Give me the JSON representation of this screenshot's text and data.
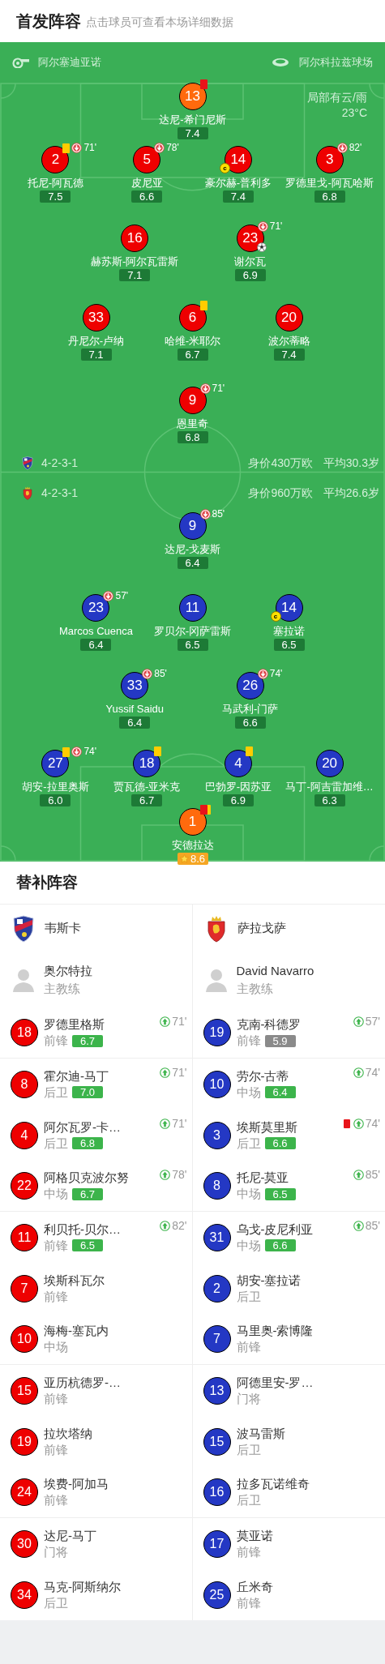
{
  "header": {
    "title": "首发阵容",
    "subtitle": "点击球员可查看本场详细数据"
  },
  "pitch": {
    "referee": "阿尔塞迪亚诺",
    "stadium": "阿尔科拉兹球场",
    "weather": "局部有云/雨",
    "temperature": "23°C",
    "home": {
      "lines": [
        {
          "players": [
            {
              "number": "13",
              "name": "达尼-希门尼斯",
              "rating": "7.4",
              "kind": "goalkeeper",
              "best": false,
              "events": [
                {
                  "kind": "red_card"
                }
              ]
            }
          ]
        },
        {
          "players": [
            {
              "number": "2",
              "name": "托尼-阿瓦德",
              "rating": "7.5",
              "kind": "outfield",
              "best": false,
              "events": [
                {
                  "kind": "yellow_card"
                },
                {
                  "kind": "sub_off",
                  "minute": "71'"
                }
              ]
            },
            {
              "number": "5",
              "name": "皮尼亚",
              "rating": "6.6",
              "kind": "outfield",
              "best": false,
              "events": [
                {
                  "kind": "sub_off",
                  "minute": "78'"
                }
              ]
            },
            {
              "number": "14",
              "name": "豪尔赫-普利多",
              "rating": "7.4",
              "kind": "outfield",
              "best": false,
              "events": [
                {
                  "kind": "captain",
                  "label": "c"
                }
              ]
            },
            {
              "number": "3",
              "name": "罗德里戈-阿瓦哈斯",
              "rating": "6.8",
              "kind": "outfield",
              "best": false,
              "events": [
                {
                  "kind": "sub_off",
                  "minute": "82'"
                }
              ]
            }
          ]
        },
        {
          "players": [
            {
              "number": "16",
              "name": "赫苏斯-阿尔瓦雷斯",
              "rating": "7.1",
              "kind": "outfield",
              "best": false
            },
            {
              "number": "23",
              "name": "谢尔瓦",
              "rating": "6.9",
              "kind": "outfield",
              "best": false,
              "events": [
                {
                  "kind": "sub_off",
                  "minute": "71'"
                },
                {
                  "kind": "goal"
                }
              ]
            }
          ]
        },
        {
          "players": [
            {
              "number": "33",
              "name": "丹尼尔-卢纳",
              "rating": "7.1",
              "kind": "outfield",
              "best": false
            },
            {
              "number": "6",
              "name": "哈维-米耶尔",
              "rating": "6.7",
              "kind": "outfield",
              "best": false,
              "events": [
                {
                  "kind": "yellow_card"
                }
              ]
            },
            {
              "number": "20",
              "name": "波尔蒂略",
              "rating": "7.4",
              "kind": "outfield",
              "best": false
            }
          ]
        },
        {
          "players": [
            {
              "number": "9",
              "name": "恩里奇",
              "rating": "6.8",
              "kind": "outfield",
              "best": false,
              "events": [
                {
                  "kind": "sub_off",
                  "minute": "71'"
                }
              ]
            }
          ]
        }
      ]
    },
    "formations": [
      {
        "formation": "4-2-3-1",
        "market_value": "身价430万欧",
        "average_age": "平均30.3岁"
      },
      {
        "formation": "4-2-3-1",
        "market_value": "身价960万欧",
        "average_age": "平均26.6岁"
      }
    ],
    "away": {
      "lines": [
        {
          "players": [
            {
              "number": "9",
              "name": "达尼-戈麦斯",
              "rating": "6.4",
              "kind": "outfield",
              "best": false,
              "events": [
                {
                  "kind": "sub_off",
                  "minute": "85'"
                }
              ]
            }
          ]
        },
        {
          "players": [
            {
              "number": "23",
              "name": "Marcos Cuenca",
              "rating": "6.4",
              "kind": "outfield",
              "best": false,
              "events": [
                {
                  "kind": "sub_off",
                  "minute": "57'"
                }
              ]
            },
            {
              "number": "11",
              "name": "罗贝尔-冈萨雷斯",
              "rating": "6.5",
              "kind": "outfield",
              "best": false
            },
            {
              "number": "14",
              "name": "塞拉诺",
              "rating": "6.5",
              "kind": "outfield",
              "best": false,
              "events": [
                {
                  "kind": "captain",
                  "label": "c"
                }
              ]
            }
          ]
        },
        {
          "players": [
            {
              "number": "33",
              "name": "Yussif Saidu",
              "rating": "6.4",
              "kind": "outfield",
              "best": false,
              "events": [
                {
                  "kind": "sub_off",
                  "minute": "85'"
                }
              ]
            },
            {
              "number": "26",
              "name": "马武利-门萨",
              "rating": "6.6",
              "kind": "outfield",
              "best": false,
              "events": [
                {
                  "kind": "sub_off",
                  "minute": "74'"
                }
              ]
            }
          ]
        },
        {
          "players": [
            {
              "number": "27",
              "name": "胡安-拉里奥斯",
              "rating": "6.0",
              "kind": "outfield",
              "best": false,
              "events": [
                {
                  "kind": "yellow_card"
                },
                {
                  "kind": "sub_off",
                  "minute": "74'"
                }
              ]
            },
            {
              "number": "18",
              "name": "贾瓦德-亚米克",
              "rating": "6.7",
              "kind": "outfield",
              "best": false,
              "events": [
                {
                  "kind": "yellow_card"
                }
              ]
            },
            {
              "number": "4",
              "name": "巴勃罗-因苏亚",
              "rating": "6.9",
              "kind": "outfield",
              "best": false,
              "events": [
                {
                  "kind": "yellow_card"
                }
              ]
            },
            {
              "number": "20",
              "name": "马丁-阿吉雷加维…",
              "rating": "6.3",
              "kind": "outfield",
              "best": false
            }
          ]
        },
        {
          "players": [
            {
              "number": "1",
              "name": "安德拉达",
              "rating": "8.6",
              "kind": "goalkeeper",
              "best": true,
              "events": [
                {
                  "kind": "red_card"
                },
                {
                  "kind": "yellow_card"
                }
              ]
            }
          ]
        }
      ]
    }
  },
  "subs": {
    "title": "替补阵容",
    "teams": [
      {
        "team_name": "韦斯卡",
        "coach": {
          "name": "奥尔特拉",
          "role": "主教练"
        },
        "players": [
          {
            "number": "18",
            "name": "罗德里格斯",
            "position": "前锋",
            "rating": "6.7",
            "rating_low": false,
            "events": [
              {
                "kind": "sub_on",
                "minute": "71'"
              }
            ]
          },
          {
            "number": "8",
            "name": "霍尔迪-马丁",
            "position": "后卫",
            "rating": "7.0",
            "rating_low": false,
            "events": [
              {
                "kind": "sub_on",
                "minute": "71'"
              }
            ]
          },
          {
            "number": "4",
            "name": "阿尔瓦罗-卡…",
            "position": "后卫",
            "rating": "6.8",
            "rating_low": false,
            "events": [
              {
                "kind": "sub_on",
                "minute": "71'"
              }
            ]
          },
          {
            "number": "22",
            "name": "阿格贝克波尔努",
            "position": "中场",
            "rating": "6.7",
            "rating_low": false,
            "events": [
              {
                "kind": "sub_on",
                "minute": "78'"
              }
            ]
          },
          {
            "number": "11",
            "name": "利贝托-贝尔…",
            "position": "前锋",
            "rating": "6.5",
            "rating_low": false,
            "events": [
              {
                "kind": "sub_on",
                "minute": "82'"
              }
            ]
          },
          {
            "number": "7",
            "name": "埃斯科瓦尔",
            "position": "前锋"
          },
          {
            "number": "10",
            "name": "海梅-塞瓦内",
            "position": "中场"
          },
          {
            "number": "15",
            "name": "亚历杭德罗-…",
            "position": "前锋"
          },
          {
            "number": "19",
            "name": "拉坎塔纳",
            "position": "前锋"
          },
          {
            "number": "24",
            "name": "埃费-阿加马",
            "position": "前锋"
          },
          {
            "number": "30",
            "name": "达尼-马丁",
            "position": "门将"
          },
          {
            "number": "34",
            "name": "马克-阿斯纳尔",
            "position": "后卫"
          }
        ]
      },
      {
        "team_name": "萨拉戈萨",
        "coach": {
          "name": "David Navarro",
          "role": "主教练"
        },
        "players": [
          {
            "number": "19",
            "name": "克南-科德罗",
            "position": "前锋",
            "rating": "5.9",
            "rating_low": true,
            "events": [
              {
                "kind": "sub_on",
                "minute": "57'"
              }
            ]
          },
          {
            "number": "10",
            "name": "劳尔-古蒂",
            "position": "中场",
            "rating": "6.4",
            "rating_low": false,
            "events": [
              {
                "kind": "sub_on",
                "minute": "74'"
              }
            ]
          },
          {
            "number": "3",
            "name": "埃斯莫里斯",
            "position": "后卫",
            "rating": "6.6",
            "rating_low": false,
            "events": [
              {
                "kind": "red_card"
              },
              {
                "kind": "sub_on",
                "minute": "74'"
              }
            ]
          },
          {
            "number": "8",
            "name": "托尼-莫亚",
            "position": "中场",
            "rating": "6.5",
            "rating_low": false,
            "events": [
              {
                "kind": "sub_on",
                "minute": "85'"
              }
            ]
          },
          {
            "number": "31",
            "name": "乌戈-皮尼利亚",
            "position": "中场",
            "rating": "6.6",
            "rating_low": false,
            "events": [
              {
                "kind": "sub_on",
                "minute": "85'"
              }
            ]
          },
          {
            "number": "2",
            "name": "胡安-塞拉诺",
            "position": "后卫"
          },
          {
            "number": "7",
            "name": "马里奥-索博隆",
            "position": "前锋"
          },
          {
            "number": "13",
            "name": "阿德里安-罗…",
            "position": "门将"
          },
          {
            "number": "15",
            "name": "波马雷斯",
            "position": "后卫"
          },
          {
            "number": "16",
            "name": "拉多瓦诺维奇",
            "position": "后卫"
          },
          {
            "number": "17",
            "name": "莫亚诺",
            "position": "前锋"
          },
          {
            "number": "25",
            "name": "丘米奇",
            "position": "前锋"
          }
        ]
      }
    ]
  }
}
